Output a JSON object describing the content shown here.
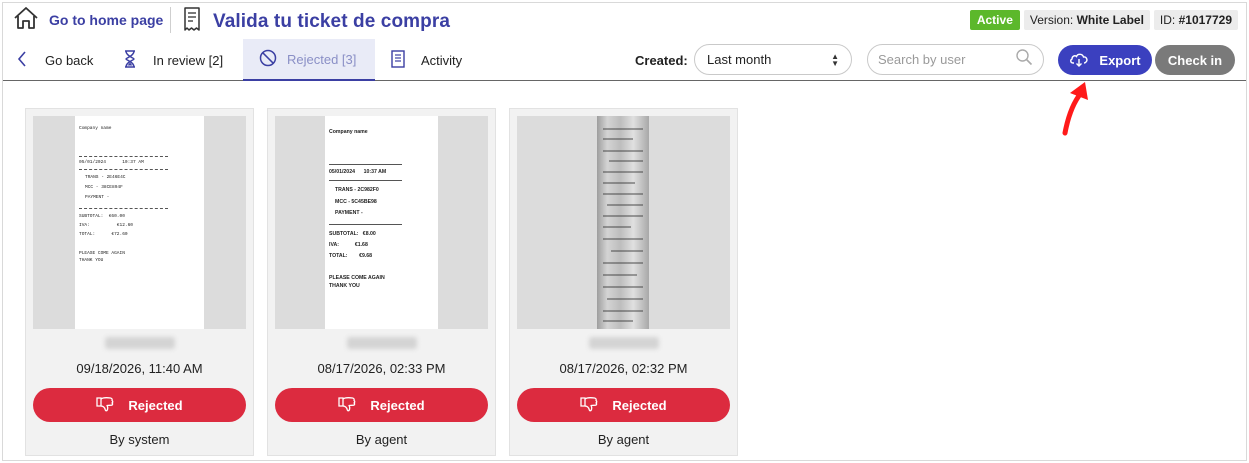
{
  "header": {
    "home_label": "Go to home page",
    "title": "Valida tu ticket de compra",
    "status": "Active",
    "version_prefix": "Version:",
    "version_value": "White Label",
    "id_prefix": "ID:",
    "id_value": "#1017729",
    "status_color": "#5cb82b"
  },
  "toolbar": {
    "go_back": "Go back",
    "tab_review": "In review [2]",
    "tab_rejected": "Rejected [3]",
    "tab_activity": "Activity",
    "created_label": "Created:",
    "created_value": "Last month",
    "search_placeholder": "Search by user",
    "export_label": "Export",
    "checkin_label": "Check in",
    "export_color": "#3b40bf"
  },
  "tickets": [
    {
      "date": "09/18/2026, 11:40 AM",
      "status_label": "Rejected",
      "by": "By system",
      "receipt": {
        "company": "Company name",
        "datetime": "05/01/2024      10:37 AM",
        "trans": "TRANS - 2E46E4C",
        "mcc": "MCC - 38CE894F",
        "payment": "PAYMENT -",
        "subtotal": "SUBTOTAL:  €60.00",
        "iva": "IVA:          €12.60",
        "total": "TOTAL:      €72.60",
        "footer1": "PLEASE COME AGAIN",
        "footer2": "THANK YOU"
      }
    },
    {
      "date": "08/17/2026, 02:33 PM",
      "status_label": "Rejected",
      "by": "By agent",
      "receipt": {
        "company": "Company name",
        "datetime": "05/01/2024      10:37 AM",
        "trans": "TRANS - 2C982F0",
        "mcc": "MCC - 5C45BE98",
        "payment": "PAYMENT -",
        "subtotal": "SUBTOTAL:   €8.00",
        "iva": "IVA:           €1.68",
        "total": "TOTAL:        €9.68",
        "footer1": "PLEASE COME AGAIN",
        "footer2": "THANK YOU"
      }
    },
    {
      "date": "08/17/2026, 02:32 PM",
      "status_label": "Rejected",
      "by": "By agent"
    }
  ],
  "colors": {
    "rejected": "#dc2b3f",
    "brand": "#3b3fa3",
    "annotation_arrow": "#ff1a1a"
  }
}
